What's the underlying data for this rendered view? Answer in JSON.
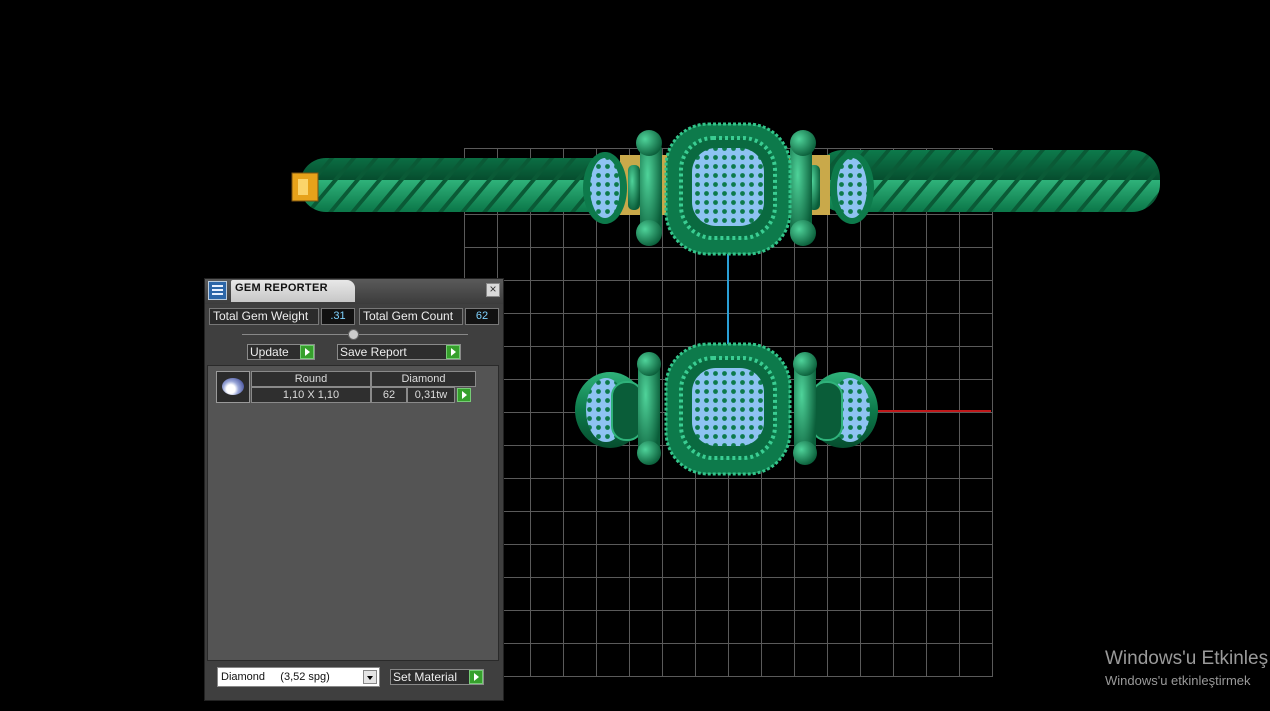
{
  "panel": {
    "title": "GEM REPORTER",
    "close_glyph": "×",
    "total_weight_label": "Total Gem Weight",
    "total_weight_value": ".31",
    "total_count_label": "Total Gem Count",
    "total_count_value": "62",
    "update_label": "Update",
    "save_report_label": "Save Report",
    "row": {
      "shape": "Round",
      "material": "Diamond",
      "size": "1,10 X 1,10",
      "count": "62",
      "weight": "0,31tw"
    },
    "material_select": "Diamond     (3,52 spg)",
    "set_material_label": "Set Material"
  },
  "watermark": {
    "title": "Windows'u Etkinleş",
    "subtitle": "Windows'u etkinleştirmek"
  },
  "colors": {
    "model_green": "#0f7a4a",
    "gem_blue": "#7ab3ea",
    "metal_gold": "#c9a94a",
    "accent_green": "#36a02c"
  }
}
